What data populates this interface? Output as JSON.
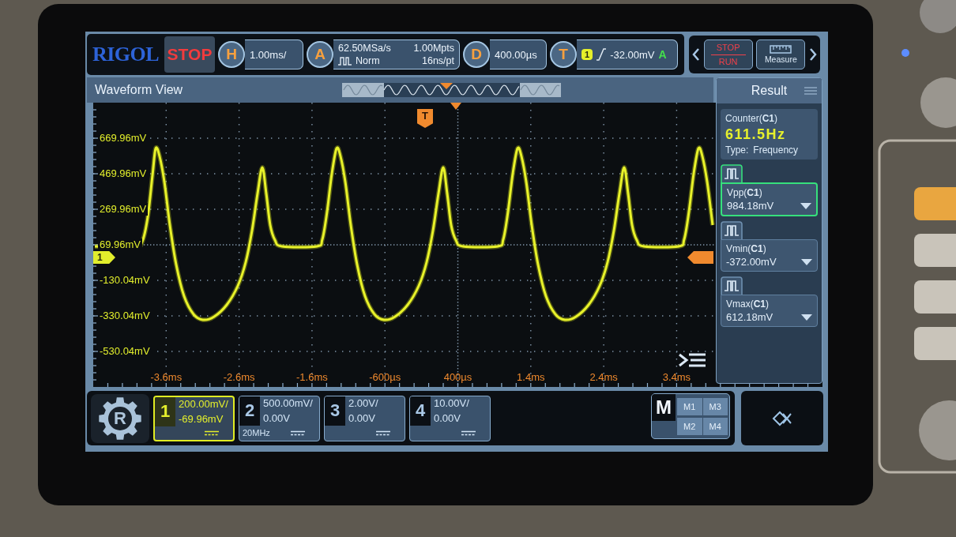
{
  "top_bar": {
    "logo": "RIGOL",
    "run_status": "STOP",
    "horizontal": {
      "key": "H",
      "value": "1.00ms/"
    },
    "acquire": {
      "key": "A",
      "sample_rate": "62.50MSa/s",
      "mode": "Norm",
      "memory_depth": "1.00Mpts",
      "time_per_point": "16ns/pt"
    },
    "delay": {
      "key": "D",
      "value": "400.00µs"
    },
    "trigger": {
      "key": "T",
      "source": "1",
      "value": "-32.00mV",
      "sweep": "A"
    },
    "quick_buttons": [
      {
        "kind": "run_stop",
        "top": "STOP",
        "bottom": "RUN"
      },
      {
        "kind": "measure",
        "label": "Measure"
      }
    ]
  },
  "waveform_view": {
    "title": "Waveform View",
    "y_labels": [
      "669.96mV",
      "469.96mV",
      "269.96mV",
      "69.96mV",
      "-130.04mV",
      "-330.04mV",
      "-530.04mV"
    ],
    "x_labels": [
      "-3.6ms",
      "-2.6ms",
      "-1.6ms",
      "-600µs",
      "400µs",
      "1.4ms",
      "2.4ms",
      "3.4ms"
    ],
    "trigger_marker": "T",
    "channel_marker": "1"
  },
  "result_panel": {
    "title": "Result",
    "counter": {
      "label": "Counter(**C1**)",
      "value": "611.5Hz",
      "type_label": "Type:",
      "type_value": "Frequency"
    },
    "measurements": [
      {
        "label": "Vpp(**C1**)",
        "value": "984.18mV",
        "selected": true
      },
      {
        "label": "Vmin(**C1**)",
        "value": "-372.00mV",
        "selected": false
      },
      {
        "label": "Vmax(**C1**)",
        "value": "612.18mV",
        "selected": false
      }
    ]
  },
  "bottom_bar": {
    "menu_button": "R",
    "channels": [
      {
        "number": "1",
        "scale": "200.00mV/",
        "offset": "-69.96mV",
        "on": true
      },
      {
        "number": "2",
        "scale": "500.00mV/",
        "offset": "0.00V",
        "bandwidth": "20MHz",
        "on": false
      },
      {
        "number": "3",
        "scale": "2.00V/",
        "offset": "0.00V",
        "on": false
      },
      {
        "number": "4",
        "scale": "10.00V/",
        "offset": "0.00V",
        "on": false
      }
    ],
    "math": {
      "label": "M",
      "slots": [
        "M1",
        "M3",
        "M2",
        "M4"
      ]
    }
  }
}
